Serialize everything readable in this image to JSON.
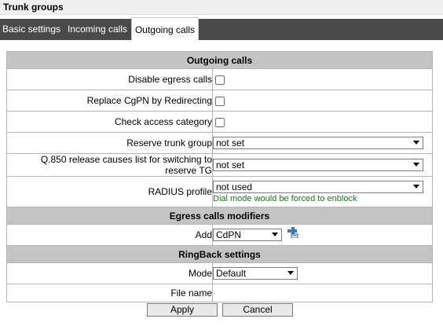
{
  "window": {
    "title": "Trunk groups"
  },
  "tabs": [
    {
      "label": "Basic settings"
    },
    {
      "label": "Incoming calls"
    },
    {
      "label": "Outgoing calls",
      "active": true
    }
  ],
  "outgoing": {
    "header": "Outgoing calls",
    "disable_egress": {
      "label": "Disable egress calls",
      "checked": false
    },
    "replace_cgpn": {
      "label": "Replace CgPN by Redirecting",
      "checked": false
    },
    "check_access": {
      "label": "Check access category",
      "checked": false
    },
    "reserve_trunk": {
      "label": "Reserve trunk group",
      "value": "not set"
    },
    "q850": {
      "label": "Q.850 release causes list for switching to reserve TG",
      "value": "not set"
    },
    "radius": {
      "label": "RADIUS profile",
      "value": "not used",
      "note": "Dial mode would be forced to enblock"
    }
  },
  "modifiers": {
    "header": "Egress calls modifiers",
    "add": {
      "label": "Add",
      "value": "CdPN"
    }
  },
  "ringback": {
    "header": "RingBack settings",
    "mode": {
      "label": "Mode",
      "value": "Default"
    },
    "file_name": {
      "label": "File name",
      "value": ""
    }
  },
  "buttons": {
    "apply": "Apply",
    "cancel": "Cancel"
  },
  "colors": {
    "tabbar": "#4a4a4a",
    "section": "#c4c4c4",
    "note": "#1e7b1e"
  }
}
